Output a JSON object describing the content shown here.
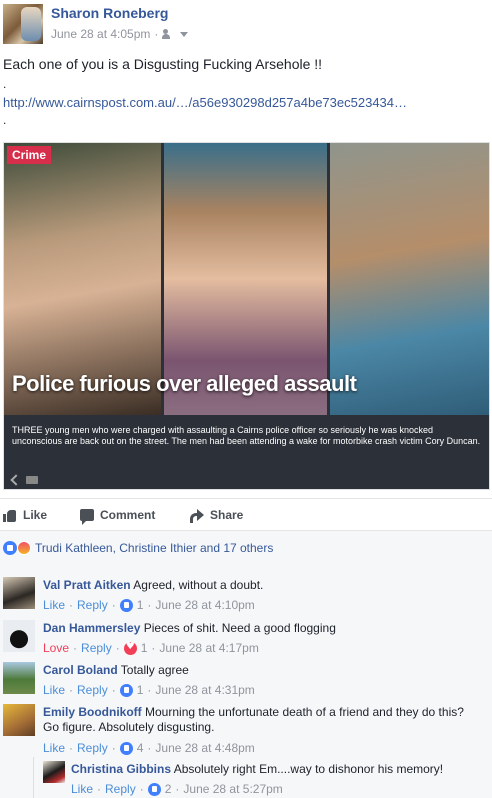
{
  "post": {
    "author": "Sharon Roneberg",
    "timestamp": "June 28 at 4:05pm",
    "separator": "·",
    "text": "Each one of you is a Disgusting Fucking Arsehole !!",
    "dot_line_1": ".",
    "link": "http://www.cairnspost.com.au/…/a56e930298d257a4be73ec523434…",
    "dot_line_2": "."
  },
  "shared_card": {
    "tag": "Crime",
    "headline": "Police furious over alleged assault",
    "blurb": "THREE young men who were charged with assaulting a Cairns police officer so seriously he was knocked unconscious are back out on the street. The men had been attending a wake for motorbike crash victim Cory Duncan."
  },
  "actions": {
    "like": "Like",
    "comment": "Comment",
    "share": "Share"
  },
  "reactions_summary": "Trudi Kathleen, Christine Ithier and 17 others",
  "comments": [
    {
      "name": "Val Pratt Aitken",
      "text": "Agreed, without a doubt.",
      "action_primary": "Like",
      "reply": "Reply",
      "reaction_count": "1",
      "timestamp": "June 28 at 4:10pm"
    },
    {
      "name": "Dan Hammersley",
      "text": "Pieces of shit. Need a good flogging",
      "action_primary": "Love",
      "reply": "Reply",
      "reaction_count": "1",
      "timestamp": "June 28 at 4:17pm"
    },
    {
      "name": "Carol Boland",
      "text": "Totally agree",
      "action_primary": "Like",
      "reply": "Reply",
      "reaction_count": "1",
      "timestamp": "June 28 at 4:31pm"
    },
    {
      "name": "Emily Boodnikoff",
      "text": "Mourning the unfortunate death of a friend and they do this? Go figure. Absolutely disgusting.",
      "action_primary": "Like",
      "reply": "Reply",
      "reaction_count": "4",
      "timestamp": "June 28 at 4:48pm"
    },
    {
      "name": "Christina Gibbins",
      "text": "Absolutely right Em....way to dishonor his memory!",
      "action_primary": "Like",
      "reply": "Reply",
      "reaction_count": "2",
      "timestamp": "June 28 at 5:27pm"
    }
  ],
  "colors": {
    "link_blue": "#365899",
    "action_blue": "#4b8ed7",
    "love_red": "#f33e58",
    "crime_tag": "#d62e4b"
  }
}
